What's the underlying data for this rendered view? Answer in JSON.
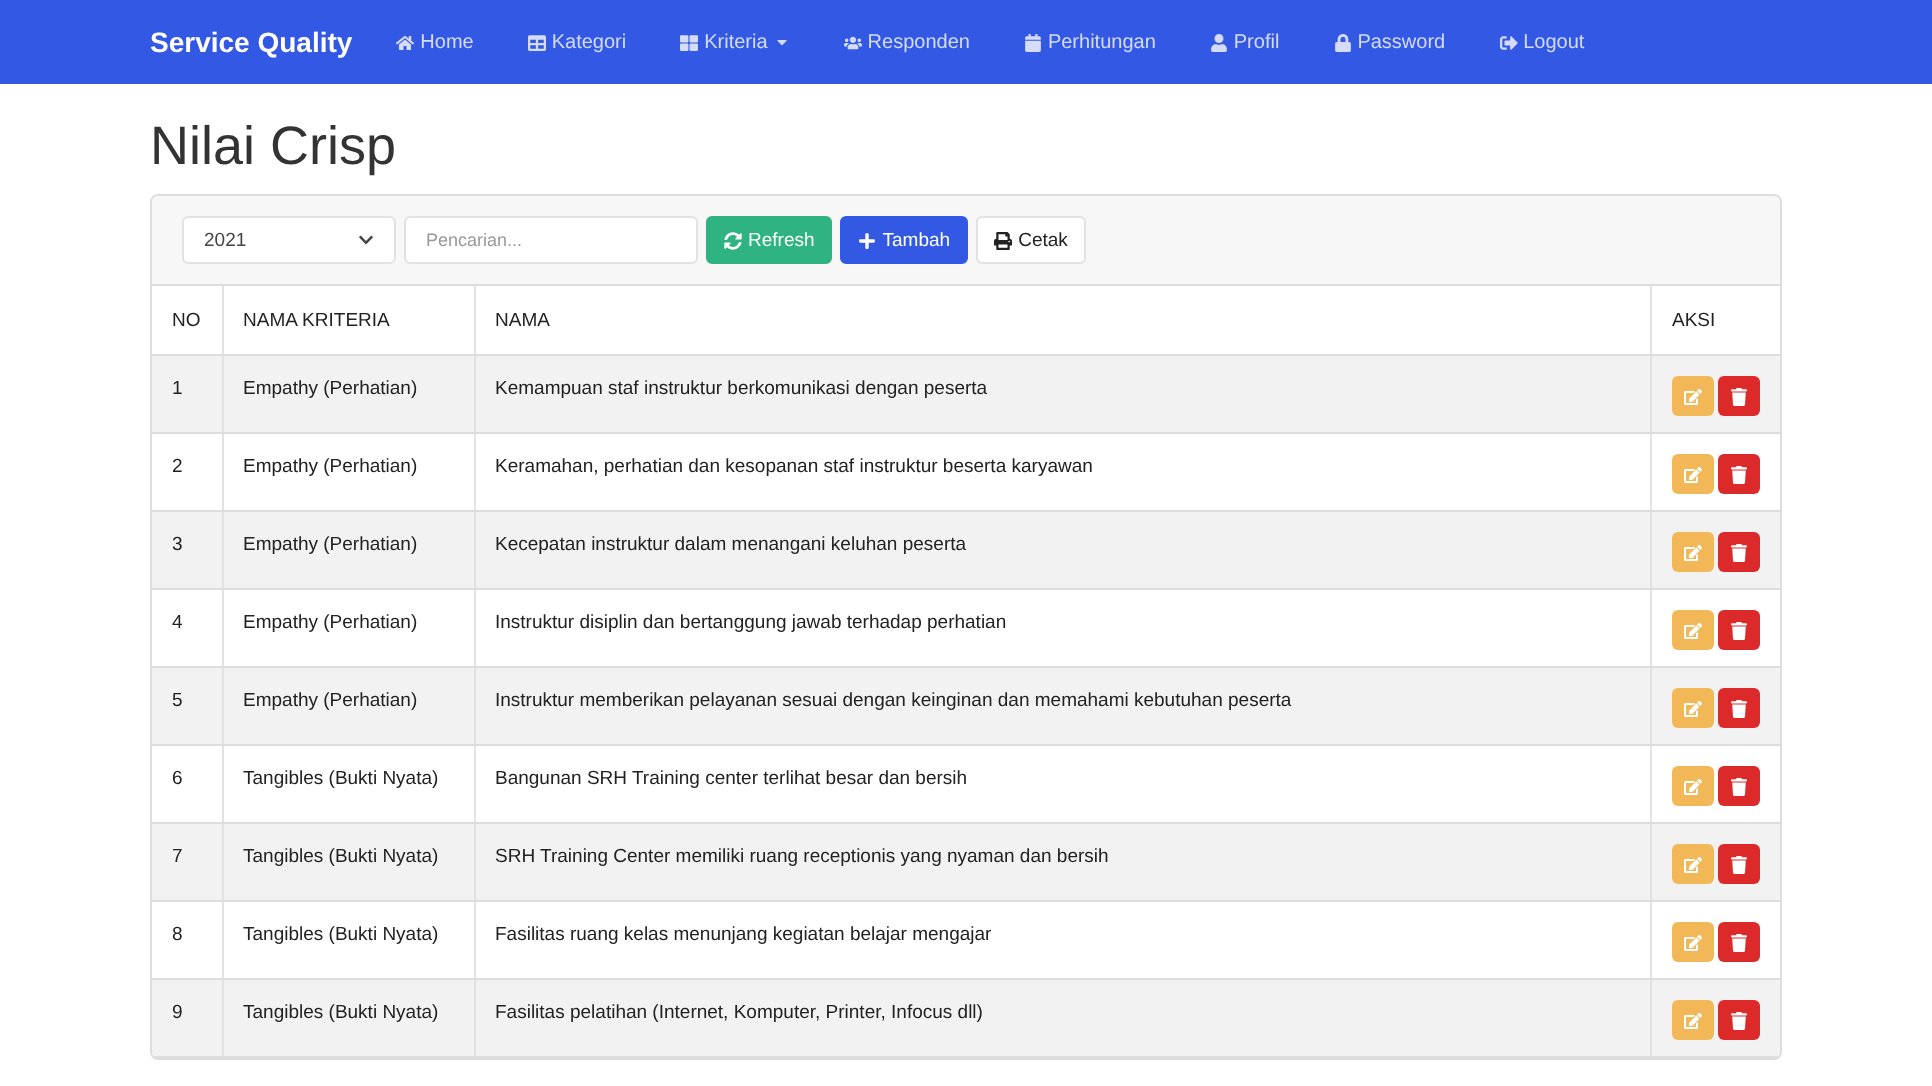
{
  "navbar": {
    "brand": "Service Quality",
    "items": [
      {
        "label": "Home",
        "dropdown": false
      },
      {
        "label": "Kategori",
        "dropdown": false
      },
      {
        "label": "Kriteria",
        "dropdown": true
      },
      {
        "label": "Responden",
        "dropdown": false
      },
      {
        "label": "Perhitungan",
        "dropdown": false
      },
      {
        "label": "Profil",
        "dropdown": false
      },
      {
        "label": "Password",
        "dropdown": false
      },
      {
        "label": "Logout",
        "dropdown": false
      }
    ]
  },
  "page_title": "Nilai Crisp",
  "toolbar": {
    "year": "2021",
    "search": {
      "placeholder": "Pencarian..."
    },
    "buttons": [
      {
        "label": "Refresh",
        "kind": "success"
      },
      {
        "label": "Tambah",
        "kind": "primary"
      },
      {
        "label": "Cetak",
        "kind": "light"
      }
    ]
  },
  "table": {
    "columns": [
      "NO",
      "NAMA KRITERIA",
      "NAMA",
      "AKSI"
    ],
    "rows": [
      {
        "no": "1",
        "kriteria": "Empathy (Perhatian)",
        "nama": "Kemampuan staf instruktur berkomunikasi dengan peserta"
      },
      {
        "no": "2",
        "kriteria": "Empathy (Perhatian)",
        "nama": "Keramahan, perhatian dan kesopanan staf instruktur beserta karyawan"
      },
      {
        "no": "3",
        "kriteria": "Empathy (Perhatian)",
        "nama": "Kecepatan instruktur dalam menangani keluhan peserta"
      },
      {
        "no": "4",
        "kriteria": "Empathy (Perhatian)",
        "nama": "Instruktur disiplin dan bertanggung jawab terhadap perhatian"
      },
      {
        "no": "5",
        "kriteria": "Empathy (Perhatian)",
        "nama": "Instruktur memberikan pelayanan sesuai dengan keinginan dan memahami kebutuhan peserta"
      },
      {
        "no": "6",
        "kriteria": "Tangibles (Bukti Nyata)",
        "nama": "Bangunan SRH Training center terlihat besar dan bersih"
      },
      {
        "no": "7",
        "kriteria": "Tangibles (Bukti Nyata)",
        "nama": "SRH Training Center memiliki ruang receptionis yang nyaman dan bersih"
      },
      {
        "no": "8",
        "kriteria": "Tangibles (Bukti Nyata)",
        "nama": "Fasilitas ruang kelas menunjang kegiatan belajar mengajar"
      },
      {
        "no": "9",
        "kriteria": "Tangibles (Bukti Nyata)",
        "nama": "Fasilitas pelatihan (Internet, Komputer, Printer, Infocus dll)"
      }
    ]
  }
}
